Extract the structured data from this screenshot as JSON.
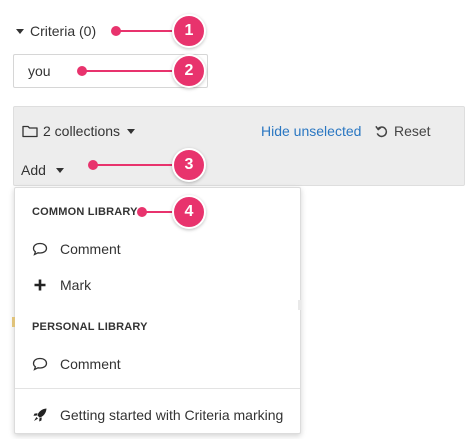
{
  "criteria": {
    "label": "Criteria (0)"
  },
  "search": {
    "value": "you"
  },
  "toolbar": {
    "collections_label": "2 collections",
    "hide_unselected_label": "Hide unselected",
    "reset_label": "Reset",
    "add_label": "Add"
  },
  "menu": {
    "common_heading": "COMMON LIBRARY",
    "common_items": [
      {
        "label": "Comment",
        "icon": "speech-bubble-icon"
      },
      {
        "label": "Mark",
        "icon": "plus-icon"
      }
    ],
    "personal_heading": "PERSONAL LIBRARY",
    "personal_items": [
      {
        "label": "Comment",
        "icon": "speech-bubble-icon"
      }
    ],
    "footer_item": {
      "label": "Getting started with Criteria marking",
      "icon": "rocket-icon"
    }
  },
  "callouts": [
    "1",
    "2",
    "3",
    "4"
  ],
  "colors": {
    "accent": "#e8336d",
    "link": "#2a77c2",
    "toolbar_bg": "#ededed"
  }
}
